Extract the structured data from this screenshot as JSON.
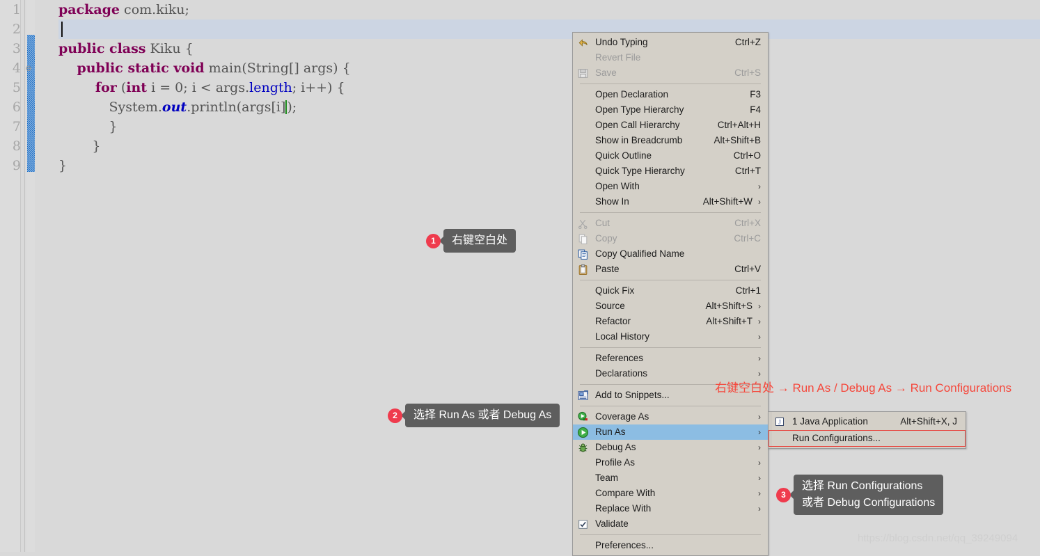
{
  "editor": {
    "lines": [
      {
        "num": "1",
        "fold": "",
        "html_parts": [
          {
            "t": "package",
            "c": "kw"
          },
          {
            "t": " com.kiku;",
            "c": "pl"
          }
        ]
      },
      {
        "num": "2",
        "fold": "",
        "html_parts": []
      },
      {
        "num": "3",
        "fold": "",
        "html_parts": [
          {
            "t": "public class",
            "c": "kw"
          },
          {
            "t": " Kiku {",
            "c": "pl"
          }
        ]
      },
      {
        "num": "4",
        "fold": "⊖",
        "html_parts": [
          {
            "t": "    public static void",
            "c": "kw"
          },
          {
            "t": " main(String[] args) {",
            "c": "pl"
          }
        ]
      },
      {
        "num": "5",
        "fold": "",
        "html_parts": [
          {
            "t": "        for",
            "c": "kw"
          },
          {
            "t": " (",
            "c": "pl"
          },
          {
            "t": "int",
            "c": "kw"
          },
          {
            "t": " i = 0; i < args.",
            "c": "pl"
          },
          {
            "t": "length",
            "c": "fld"
          },
          {
            "t": "; i++) {",
            "c": "pl"
          }
        ]
      },
      {
        "num": "6",
        "fold": "",
        "html_parts": [
          {
            "t": "            System.",
            "c": "pl"
          },
          {
            "t": "out",
            "c": "sf"
          },
          {
            "t": ".println(args[i]);",
            "c": "pl"
          }
        ]
      },
      {
        "num": "7",
        "fold": "",
        "html_parts": [
          {
            "t": "            }",
            "c": "pl"
          }
        ]
      },
      {
        "num": "8",
        "fold": "",
        "html_parts": [
          {
            "t": "        }",
            "c": "pl"
          }
        ]
      },
      {
        "num": "9",
        "fold": "",
        "html_parts": [
          {
            "t": "}",
            "c": "pl"
          }
        ]
      }
    ],
    "code_text": [
      "package com.kiku;",
      "",
      "public class Kiku {",
      "    public static void main(String[] args) {",
      "        for (int i = 0; i < args.length; i++) {",
      "            System.out.println(args[i]);",
      "            }",
      "        }",
      "}"
    ]
  },
  "context_menu": {
    "items": [
      {
        "label": "Undo Typing",
        "accel": "Ctrl+Z",
        "icon": "undo-icon",
        "disabled": false,
        "submenu": false,
        "selected": false,
        "sep_after": false
      },
      {
        "label": "Revert File",
        "accel": "",
        "icon": "",
        "disabled": true,
        "submenu": false,
        "selected": false,
        "sep_after": false
      },
      {
        "label": "Save",
        "accel": "Ctrl+S",
        "icon": "save-disk-icon",
        "disabled": true,
        "submenu": false,
        "selected": false,
        "sep_after": true
      },
      {
        "label": "Open Declaration",
        "accel": "F3",
        "icon": "",
        "disabled": false,
        "submenu": false,
        "selected": false,
        "sep_after": false
      },
      {
        "label": "Open Type Hierarchy",
        "accel": "F4",
        "icon": "",
        "disabled": false,
        "submenu": false,
        "selected": false,
        "sep_after": false
      },
      {
        "label": "Open Call Hierarchy",
        "accel": "Ctrl+Alt+H",
        "icon": "",
        "disabled": false,
        "submenu": false,
        "selected": false,
        "sep_after": false
      },
      {
        "label": "Show in Breadcrumb",
        "accel": "Alt+Shift+B",
        "icon": "",
        "disabled": false,
        "submenu": false,
        "selected": false,
        "sep_after": false
      },
      {
        "label": "Quick Outline",
        "accel": "Ctrl+O",
        "icon": "",
        "disabled": false,
        "submenu": false,
        "selected": false,
        "sep_after": false
      },
      {
        "label": "Quick Type Hierarchy",
        "accel": "Ctrl+T",
        "icon": "",
        "disabled": false,
        "submenu": false,
        "selected": false,
        "sep_after": false
      },
      {
        "label": "Open With",
        "accel": "",
        "icon": "",
        "disabled": false,
        "submenu": true,
        "selected": false,
        "sep_after": false
      },
      {
        "label": "Show In",
        "accel": "Alt+Shift+W",
        "icon": "",
        "disabled": false,
        "submenu": true,
        "selected": false,
        "sep_after": true
      },
      {
        "label": "Cut",
        "accel": "Ctrl+X",
        "icon": "scissors-icon",
        "disabled": true,
        "submenu": false,
        "selected": false,
        "sep_after": false
      },
      {
        "label": "Copy",
        "accel": "Ctrl+C",
        "icon": "copy-icon",
        "disabled": true,
        "submenu": false,
        "selected": false,
        "sep_after": false
      },
      {
        "label": "Copy Qualified Name",
        "accel": "",
        "icon": "copy-qualified-icon",
        "disabled": false,
        "submenu": false,
        "selected": false,
        "sep_after": false
      },
      {
        "label": "Paste",
        "accel": "Ctrl+V",
        "icon": "clipboard-paste-icon",
        "disabled": false,
        "submenu": false,
        "selected": false,
        "sep_after": true
      },
      {
        "label": "Quick Fix",
        "accel": "Ctrl+1",
        "icon": "",
        "disabled": false,
        "submenu": false,
        "selected": false,
        "sep_after": false
      },
      {
        "label": "Source",
        "accel": "Alt+Shift+S",
        "icon": "",
        "disabled": false,
        "submenu": true,
        "selected": false,
        "sep_after": false
      },
      {
        "label": "Refactor",
        "accel": "Alt+Shift+T",
        "icon": "",
        "disabled": false,
        "submenu": true,
        "selected": false,
        "sep_after": false
      },
      {
        "label": "Local History",
        "accel": "",
        "icon": "",
        "disabled": false,
        "submenu": true,
        "selected": false,
        "sep_after": true
      },
      {
        "label": "References",
        "accel": "",
        "icon": "",
        "disabled": false,
        "submenu": true,
        "selected": false,
        "sep_after": false
      },
      {
        "label": "Declarations",
        "accel": "",
        "icon": "",
        "disabled": false,
        "submenu": true,
        "selected": false,
        "sep_after": true
      },
      {
        "label": "Add to Snippets...",
        "accel": "",
        "icon": "snippets-icon",
        "disabled": false,
        "submenu": false,
        "selected": false,
        "sep_after": true
      },
      {
        "label": "Coverage As",
        "accel": "",
        "icon": "coverage-icon",
        "disabled": false,
        "submenu": true,
        "selected": false,
        "sep_after": false
      },
      {
        "label": "Run As",
        "accel": "",
        "icon": "run-icon",
        "disabled": false,
        "submenu": true,
        "selected": true,
        "sep_after": false
      },
      {
        "label": "Debug As",
        "accel": "",
        "icon": "debug-bug-icon",
        "disabled": false,
        "submenu": true,
        "selected": false,
        "sep_after": false
      },
      {
        "label": "Profile As",
        "accel": "",
        "icon": "",
        "disabled": false,
        "submenu": true,
        "selected": false,
        "sep_after": false
      },
      {
        "label": "Team",
        "accel": "",
        "icon": "",
        "disabled": false,
        "submenu": true,
        "selected": false,
        "sep_after": false
      },
      {
        "label": "Compare With",
        "accel": "",
        "icon": "",
        "disabled": false,
        "submenu": true,
        "selected": false,
        "sep_after": false
      },
      {
        "label": "Replace With",
        "accel": "",
        "icon": "",
        "disabled": false,
        "submenu": true,
        "selected": false,
        "sep_after": false
      },
      {
        "label": "Validate",
        "accel": "",
        "icon": "checkbox-checked-icon",
        "disabled": false,
        "submenu": false,
        "selected": false,
        "sep_after": true
      },
      {
        "label": "Preferences...",
        "accel": "",
        "icon": "",
        "disabled": false,
        "submenu": false,
        "selected": false,
        "sep_after": false
      }
    ]
  },
  "run_as_submenu": {
    "items": [
      {
        "label": "1 Java Application",
        "accel": "Alt+Shift+X, J",
        "icon": "java-app-icon",
        "outlined": false
      },
      {
        "label": "Run Configurations...",
        "accel": "",
        "icon": "",
        "outlined": true
      }
    ]
  },
  "callouts": [
    {
      "num": "1",
      "text": "右键空白处"
    },
    {
      "num": "2",
      "text": "选择 Run As 或者 Debug As"
    },
    {
      "num": "3",
      "text": "选择 Run Configurations\n或者 Debug Configurations"
    }
  ],
  "red_note": "右键空白处 → Run As / Debug As → Run Configurations",
  "watermark": "https://blog.csdn.net/qq_39249094",
  "colors": {
    "background": "#d9d9d9",
    "menu_bg": "#d4d0c8",
    "menu_selected": "#8cbde3",
    "keyword": "#7f0055",
    "field": "#0000c0",
    "badge": "#ef3b4d",
    "bubble": "#5e5e5e",
    "red_note": "#f5483c",
    "highlight_line": "#ccd5e3",
    "marker_bar": "#1f6fc4",
    "outline_red": "#e8413a"
  }
}
